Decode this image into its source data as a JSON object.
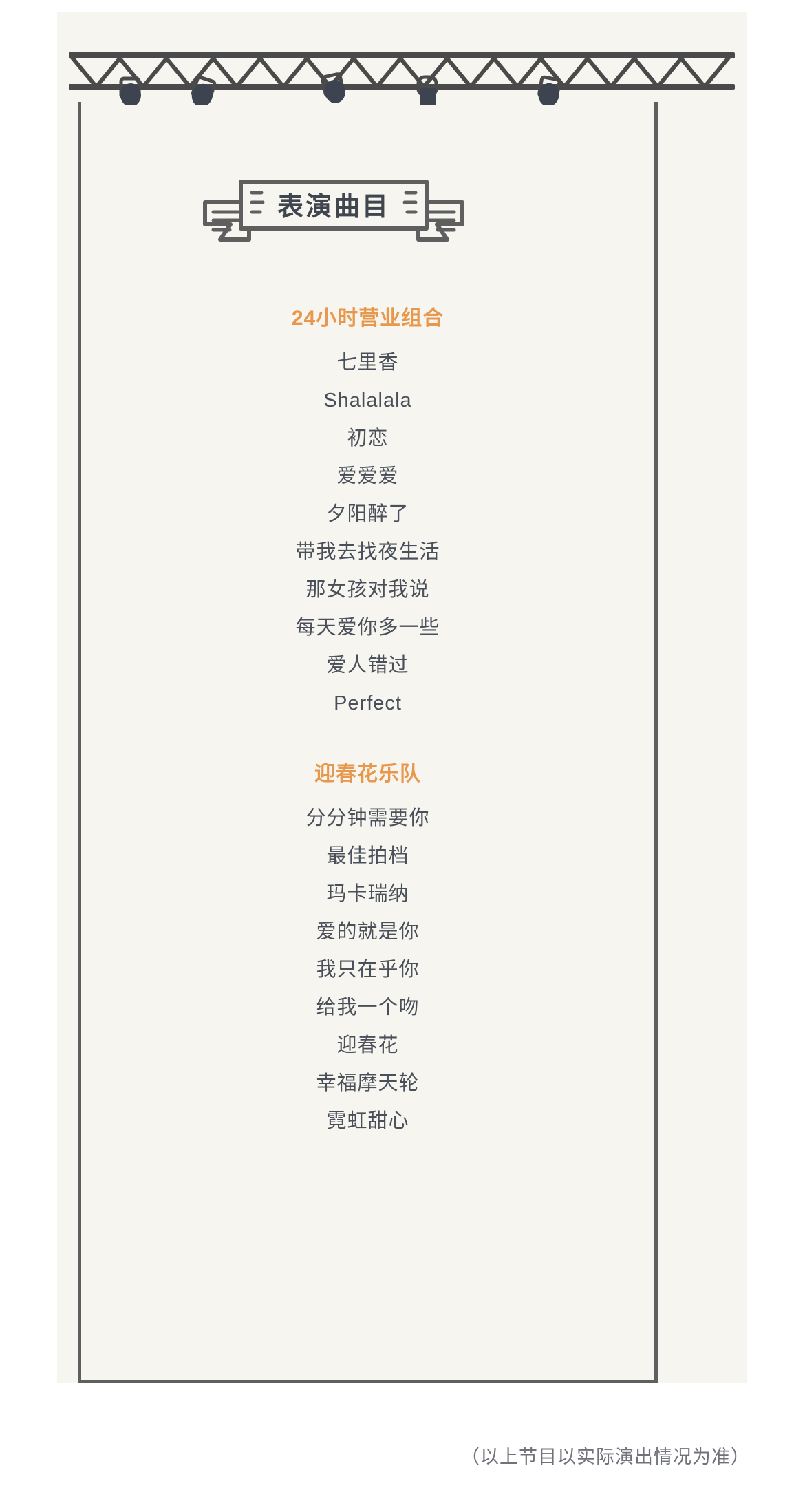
{
  "banner": {
    "title": "表演曲目"
  },
  "decor": {
    "truss_icon": "stage-truss-with-spotlights",
    "ribbon_icon": "ribbon-banner"
  },
  "colors": {
    "panel_bg": "#f6f5f0",
    "page_bg": "#ffffff",
    "frame_border": "#5f5f5f",
    "accent_orange": "#e8984c",
    "song_text": "#4a5059",
    "title_text": "#40464e",
    "footer_text": "#6f7379"
  },
  "sections": [
    {
      "title": "24小时营业组合",
      "songs": [
        "七里香",
        "Shalalala",
        "初恋",
        "爱爱爱",
        "夕阳醉了",
        "带我去找夜生活",
        "那女孩对我说",
        "每天爱你多一些",
        "爱人错过",
        "Perfect"
      ]
    },
    {
      "title": "迎春花乐队",
      "songs": [
        "分分钟需要你",
        "最佳拍档",
        "玛卡瑞纳",
        "爱的就是你",
        "我只在乎你",
        "给我一个吻",
        "迎春花",
        "幸福摩天轮",
        "霓虹甜心"
      ]
    }
  ],
  "footer": {
    "note": "（以上节目以实际演出情况为准）"
  }
}
